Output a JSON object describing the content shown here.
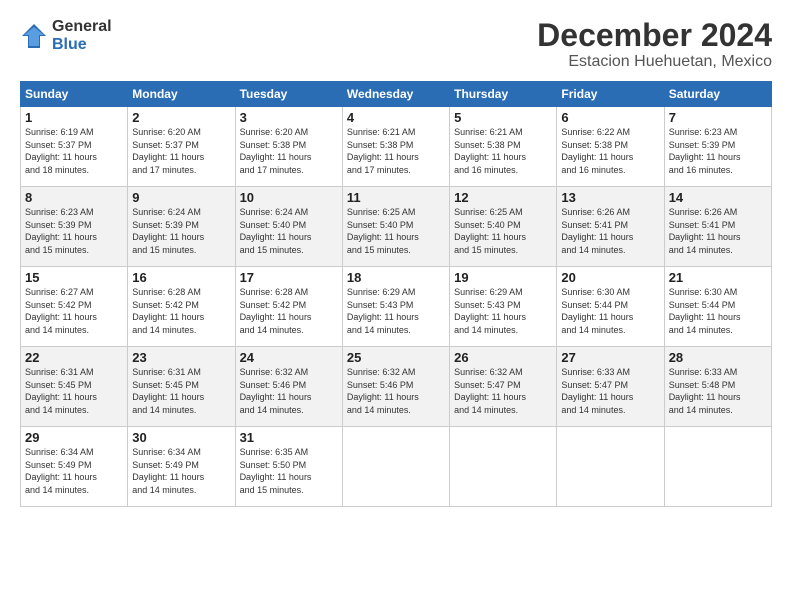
{
  "header": {
    "logo_general": "General",
    "logo_blue": "Blue",
    "month_title": "December 2024",
    "location": "Estacion Huehuetan, Mexico"
  },
  "calendar": {
    "days_of_week": [
      "Sunday",
      "Monday",
      "Tuesday",
      "Wednesday",
      "Thursday",
      "Friday",
      "Saturday"
    ],
    "weeks": [
      [
        {
          "day": "",
          "info": ""
        },
        {
          "day": "2",
          "info": "Sunrise: 6:20 AM\nSunset: 5:37 PM\nDaylight: 11 hours\nand 17 minutes."
        },
        {
          "day": "3",
          "info": "Sunrise: 6:20 AM\nSunset: 5:38 PM\nDaylight: 11 hours\nand 17 minutes."
        },
        {
          "day": "4",
          "info": "Sunrise: 6:21 AM\nSunset: 5:38 PM\nDaylight: 11 hours\nand 17 minutes."
        },
        {
          "day": "5",
          "info": "Sunrise: 6:21 AM\nSunset: 5:38 PM\nDaylight: 11 hours\nand 16 minutes."
        },
        {
          "day": "6",
          "info": "Sunrise: 6:22 AM\nSunset: 5:38 PM\nDaylight: 11 hours\nand 16 minutes."
        },
        {
          "day": "7",
          "info": "Sunrise: 6:23 AM\nSunset: 5:39 PM\nDaylight: 11 hours\nand 16 minutes."
        }
      ],
      [
        {
          "day": "8",
          "info": "Sunrise: 6:23 AM\nSunset: 5:39 PM\nDaylight: 11 hours\nand 15 minutes."
        },
        {
          "day": "9",
          "info": "Sunrise: 6:24 AM\nSunset: 5:39 PM\nDaylight: 11 hours\nand 15 minutes."
        },
        {
          "day": "10",
          "info": "Sunrise: 6:24 AM\nSunset: 5:40 PM\nDaylight: 11 hours\nand 15 minutes."
        },
        {
          "day": "11",
          "info": "Sunrise: 6:25 AM\nSunset: 5:40 PM\nDaylight: 11 hours\nand 15 minutes."
        },
        {
          "day": "12",
          "info": "Sunrise: 6:25 AM\nSunset: 5:40 PM\nDaylight: 11 hours\nand 15 minutes."
        },
        {
          "day": "13",
          "info": "Sunrise: 6:26 AM\nSunset: 5:41 PM\nDaylight: 11 hours\nand 14 minutes."
        },
        {
          "day": "14",
          "info": "Sunrise: 6:26 AM\nSunset: 5:41 PM\nDaylight: 11 hours\nand 14 minutes."
        }
      ],
      [
        {
          "day": "15",
          "info": "Sunrise: 6:27 AM\nSunset: 5:42 PM\nDaylight: 11 hours\nand 14 minutes."
        },
        {
          "day": "16",
          "info": "Sunrise: 6:28 AM\nSunset: 5:42 PM\nDaylight: 11 hours\nand 14 minutes."
        },
        {
          "day": "17",
          "info": "Sunrise: 6:28 AM\nSunset: 5:42 PM\nDaylight: 11 hours\nand 14 minutes."
        },
        {
          "day": "18",
          "info": "Sunrise: 6:29 AM\nSunset: 5:43 PM\nDaylight: 11 hours\nand 14 minutes."
        },
        {
          "day": "19",
          "info": "Sunrise: 6:29 AM\nSunset: 5:43 PM\nDaylight: 11 hours\nand 14 minutes."
        },
        {
          "day": "20",
          "info": "Sunrise: 6:30 AM\nSunset: 5:44 PM\nDaylight: 11 hours\nand 14 minutes."
        },
        {
          "day": "21",
          "info": "Sunrise: 6:30 AM\nSunset: 5:44 PM\nDaylight: 11 hours\nand 14 minutes."
        }
      ],
      [
        {
          "day": "22",
          "info": "Sunrise: 6:31 AM\nSunset: 5:45 PM\nDaylight: 11 hours\nand 14 minutes."
        },
        {
          "day": "23",
          "info": "Sunrise: 6:31 AM\nSunset: 5:45 PM\nDaylight: 11 hours\nand 14 minutes."
        },
        {
          "day": "24",
          "info": "Sunrise: 6:32 AM\nSunset: 5:46 PM\nDaylight: 11 hours\nand 14 minutes."
        },
        {
          "day": "25",
          "info": "Sunrise: 6:32 AM\nSunset: 5:46 PM\nDaylight: 11 hours\nand 14 minutes."
        },
        {
          "day": "26",
          "info": "Sunrise: 6:32 AM\nSunset: 5:47 PM\nDaylight: 11 hours\nand 14 minutes."
        },
        {
          "day": "27",
          "info": "Sunrise: 6:33 AM\nSunset: 5:47 PM\nDaylight: 11 hours\nand 14 minutes."
        },
        {
          "day": "28",
          "info": "Sunrise: 6:33 AM\nSunset: 5:48 PM\nDaylight: 11 hours\nand 14 minutes."
        }
      ],
      [
        {
          "day": "29",
          "info": "Sunrise: 6:34 AM\nSunset: 5:49 PM\nDaylight: 11 hours\nand 14 minutes."
        },
        {
          "day": "30",
          "info": "Sunrise: 6:34 AM\nSunset: 5:49 PM\nDaylight: 11 hours\nand 14 minutes."
        },
        {
          "day": "31",
          "info": "Sunrise: 6:35 AM\nSunset: 5:50 PM\nDaylight: 11 hours\nand 15 minutes."
        },
        {
          "day": "",
          "info": ""
        },
        {
          "day": "",
          "info": ""
        },
        {
          "day": "",
          "info": ""
        },
        {
          "day": "",
          "info": ""
        }
      ]
    ],
    "week1_day1": {
      "day": "1",
      "info": "Sunrise: 6:19 AM\nSunset: 5:37 PM\nDaylight: 11 hours\nand 18 minutes."
    }
  }
}
